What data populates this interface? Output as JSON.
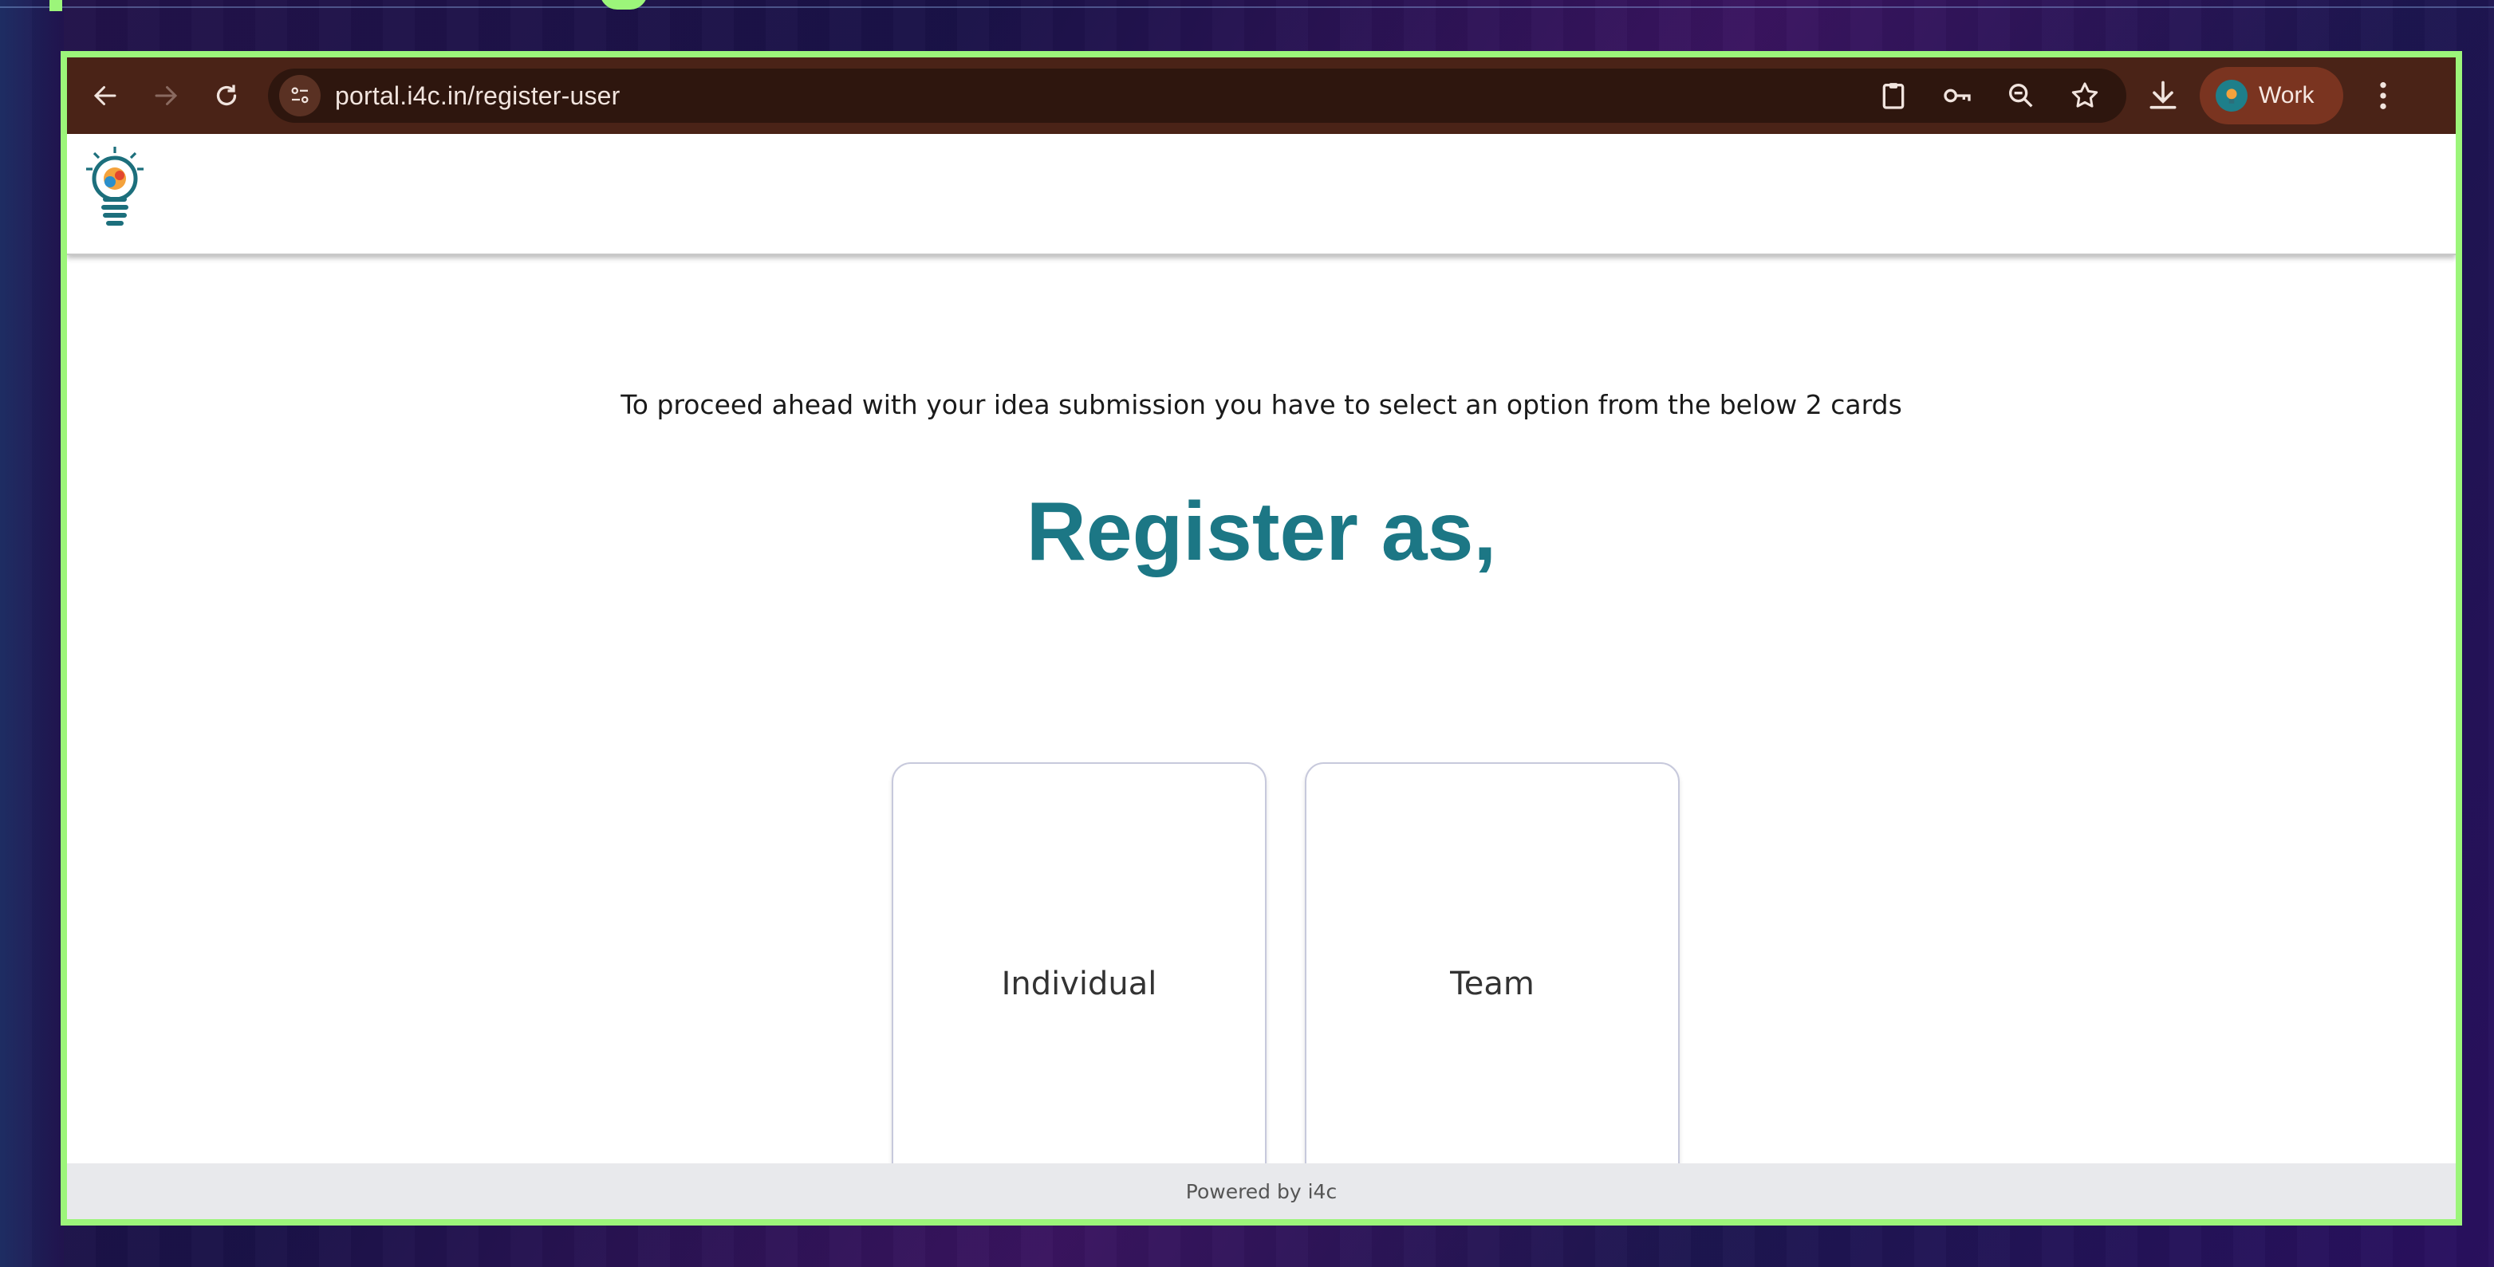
{
  "browser": {
    "url": "portal.i4c.in/register-user",
    "profile_label": "Work",
    "icons": [
      "back-arrow-icon",
      "forward-arrow-icon",
      "reload-icon",
      "site-info-icon",
      "clipboard-icon",
      "key-icon",
      "zoom-out-icon",
      "star-icon",
      "download-icon",
      "profile-avatar-icon",
      "more-vert-icon"
    ],
    "colors": {
      "toolbar": "#4a2317",
      "omnibox": "#2e160e",
      "profile_chip": "#7a3420",
      "frame_border": "#9cf57a"
    }
  },
  "page": {
    "intro": "To proceed ahead with your idea submission you have to select an option from the below 2 cards",
    "title": "Register as,",
    "cards": [
      {
        "label": "Individual"
      },
      {
        "label": "Team"
      }
    ],
    "footer": "Powered by i4c",
    "colors": {
      "title": "#1c7785",
      "footer_bg": "#e8e9ec"
    }
  }
}
